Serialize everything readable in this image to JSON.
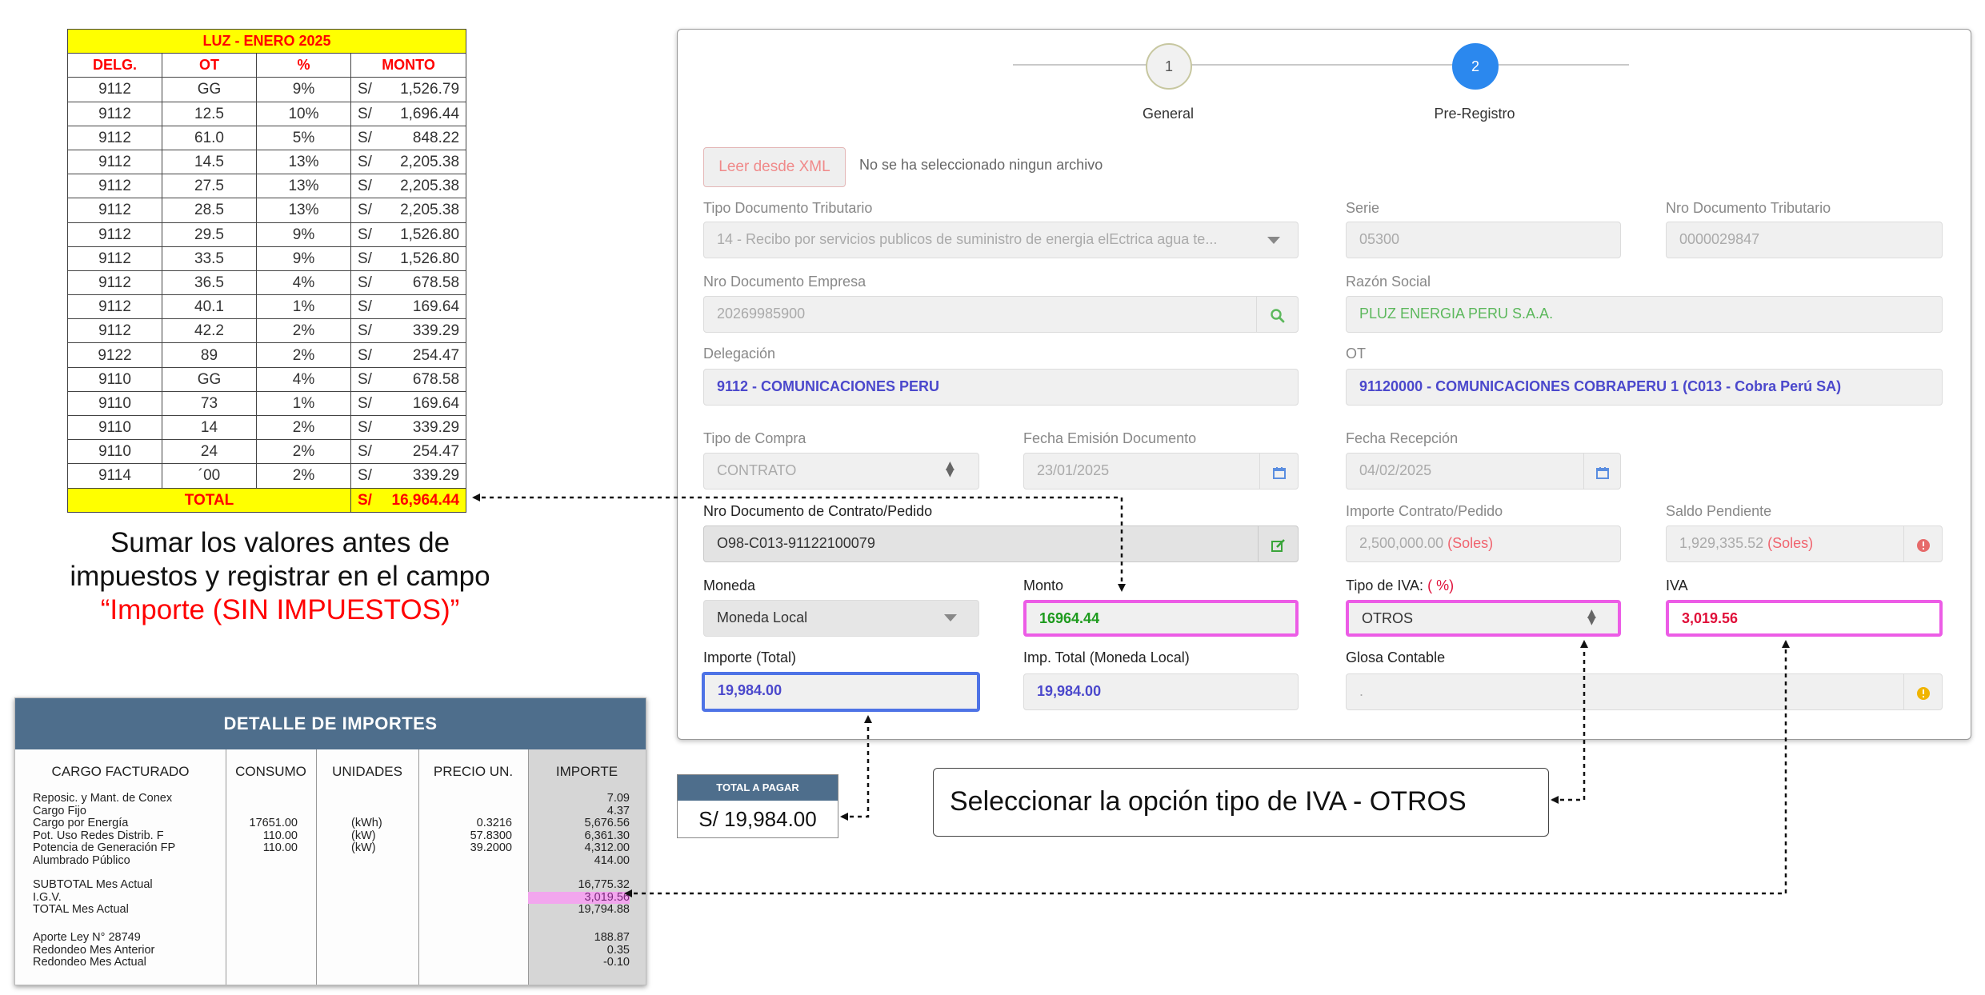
{
  "excel": {
    "title": "LUZ - ENERO 2025",
    "headers": [
      "DELG.",
      "OT",
      "%",
      "MONTO"
    ],
    "currency": "S/",
    "rows": [
      [
        "9112",
        "GG",
        "9%",
        "1,526.79"
      ],
      [
        "9112",
        "12.5",
        "10%",
        "1,696.44"
      ],
      [
        "9112",
        "61.0",
        "5%",
        "848.22"
      ],
      [
        "9112",
        "14.5",
        "13%",
        "2,205.38"
      ],
      [
        "9112",
        "27.5",
        "13%",
        "2,205.38"
      ],
      [
        "9112",
        "28.5",
        "13%",
        "2,205.38"
      ],
      [
        "9112",
        "29.5",
        "9%",
        "1,526.80"
      ],
      [
        "9112",
        "33.5",
        "9%",
        "1,526.80"
      ],
      [
        "9112",
        "36.5",
        "4%",
        "678.58"
      ],
      [
        "9112",
        "40.1",
        "1%",
        "169.64"
      ],
      [
        "9112",
        "42.2",
        "2%",
        "339.29"
      ],
      [
        "9122",
        "89",
        "2%",
        "254.47"
      ],
      [
        "9110",
        "GG",
        "4%",
        "678.58"
      ],
      [
        "9110",
        "73",
        "1%",
        "169.64"
      ],
      [
        "9110",
        "14",
        "2%",
        "339.29"
      ],
      [
        "9110",
        "24",
        "2%",
        "254.47"
      ],
      [
        "9114",
        "´00",
        "2%",
        "339.29"
      ]
    ],
    "total_label": "TOTAL",
    "total_value": "16,964.44"
  },
  "note_sum": {
    "line1": "Sumar los valores antes de",
    "line2": "impuestos y registrar en el campo",
    "line3": "“Importe (SIN IMPUESTOS)”"
  },
  "invoice": {
    "title": "DETALLE DE IMPORTES",
    "columns": [
      "CARGO FACTURADO",
      "CONSUMO",
      "UNIDADES",
      "PRECIO UN.",
      "IMPORTE"
    ],
    "group1": {
      "cargos": [
        "Reposic. y Mant. de Conex",
        "Cargo Fijo",
        "Cargo por Energía",
        "Pot. Uso Redes Distrib. F",
        "Potencia de Generación FP",
        "Alumbrado Público"
      ],
      "consumo": [
        "",
        "",
        "17651.00",
        "110.00",
        "110.00",
        ""
      ],
      "unidades": [
        "",
        "",
        "(kWh)",
        "(kW)",
        "(kW)",
        ""
      ],
      "precio": [
        "",
        "",
        "0.3216",
        "57.8300",
        "39.2000",
        ""
      ],
      "importe": [
        "7.09",
        "4.37",
        "5,676.56",
        "6,361.30",
        "4,312.00",
        "414.00"
      ]
    },
    "group2": {
      "cargos": [
        "SUBTOTAL Mes Actual",
        "I.G.V.",
        "TOTAL Mes Actual"
      ],
      "importe": [
        "16,775.32",
        "3,019.56",
        "19,794.88"
      ]
    },
    "group3": {
      "cargos": [
        "Aporte Ley N° 28749",
        "Redondeo Mes Anterior",
        "Redondeo Mes Actual"
      ],
      "importe": [
        "188.87",
        "0.35",
        "-0.10"
      ]
    }
  },
  "total_pagar": {
    "label": "TOTAL A PAGAR",
    "value": "S/ 19,984.00"
  },
  "callout_iva": "Seleccionar la opción tipo de IVA - OTROS",
  "form": {
    "steps": [
      {
        "num": "1",
        "label": "General"
      },
      {
        "num": "2",
        "label": "Pre-Registro"
      }
    ],
    "xml_button": "Leer desde XML",
    "xml_status": "No se ha seleccionado ningun archivo",
    "tipo_doc_label": "Tipo Documento Tributario",
    "tipo_doc_value": "14 - Recibo por servicios publicos de suministro de energia elEctrica agua te...",
    "serie_label": "Serie",
    "serie_value": "05300",
    "nro_doc_trib_label": "Nro Documento Tributario",
    "nro_doc_trib_value": "0000029847",
    "nro_doc_emp_label": "Nro Documento Empresa",
    "nro_doc_emp_value": "20269985900",
    "razon_label": "Razón Social",
    "razon_value": "PLUZ ENERGIA PERU S.A.A.",
    "delegacion_label": "Delegación",
    "delegacion_value": "9112 - COMUNICACIONES PERU",
    "ot_label": "OT",
    "ot_value": "91120000 - COMUNICACIONES COBRAPERU 1 (C013 - Cobra Perú SA)",
    "tipo_compra_label": "Tipo de Compra",
    "tipo_compra_value": "CONTRATO",
    "fecha_emision_label": "Fecha Emisión Documento",
    "fecha_emision_value": "23/01/2025",
    "fecha_recepcion_label": "Fecha Recepción",
    "fecha_recepcion_value": "04/02/2025",
    "contrato_label": "Nro Documento de Contrato/Pedido",
    "contrato_value": "O98-C013-91122100079",
    "importe_contrato_label": "Importe Contrato/Pedido",
    "importe_contrato_value": "2,500,000.00",
    "saldo_label": "Saldo Pendiente",
    "saldo_value": "1,929,335.52",
    "soles_tag": "(Soles)",
    "moneda_label": "Moneda",
    "moneda_value": "Moneda Local",
    "monto_label": "Monto",
    "monto_value": "16964.44",
    "tipo_iva_label": "Tipo de IVA:",
    "tipo_iva_pct": "( %)",
    "tipo_iva_value": "OTROS",
    "iva_label": "IVA",
    "iva_value": "3,019.56",
    "importe_total_label": "Importe (Total)",
    "importe_total_value": "19,984.00",
    "imp_total_ml_label": "Imp. Total (Moneda Local)",
    "imp_total_ml_value": "19,984.00",
    "glosa_label": "Glosa Contable",
    "glosa_value": "."
  },
  "colors": {
    "excel_header_bg": "#ffff00",
    "excel_red": "#ff0000",
    "invoice_header": "#4e6e8c",
    "step_active": "#2b88ee",
    "highlight_pink": "#ec5ce6",
    "highlight_blue": "#4e73e6",
    "value_blue": "#4b48cc",
    "value_green": "#1e9b1e",
    "value_red": "#e0103a"
  }
}
